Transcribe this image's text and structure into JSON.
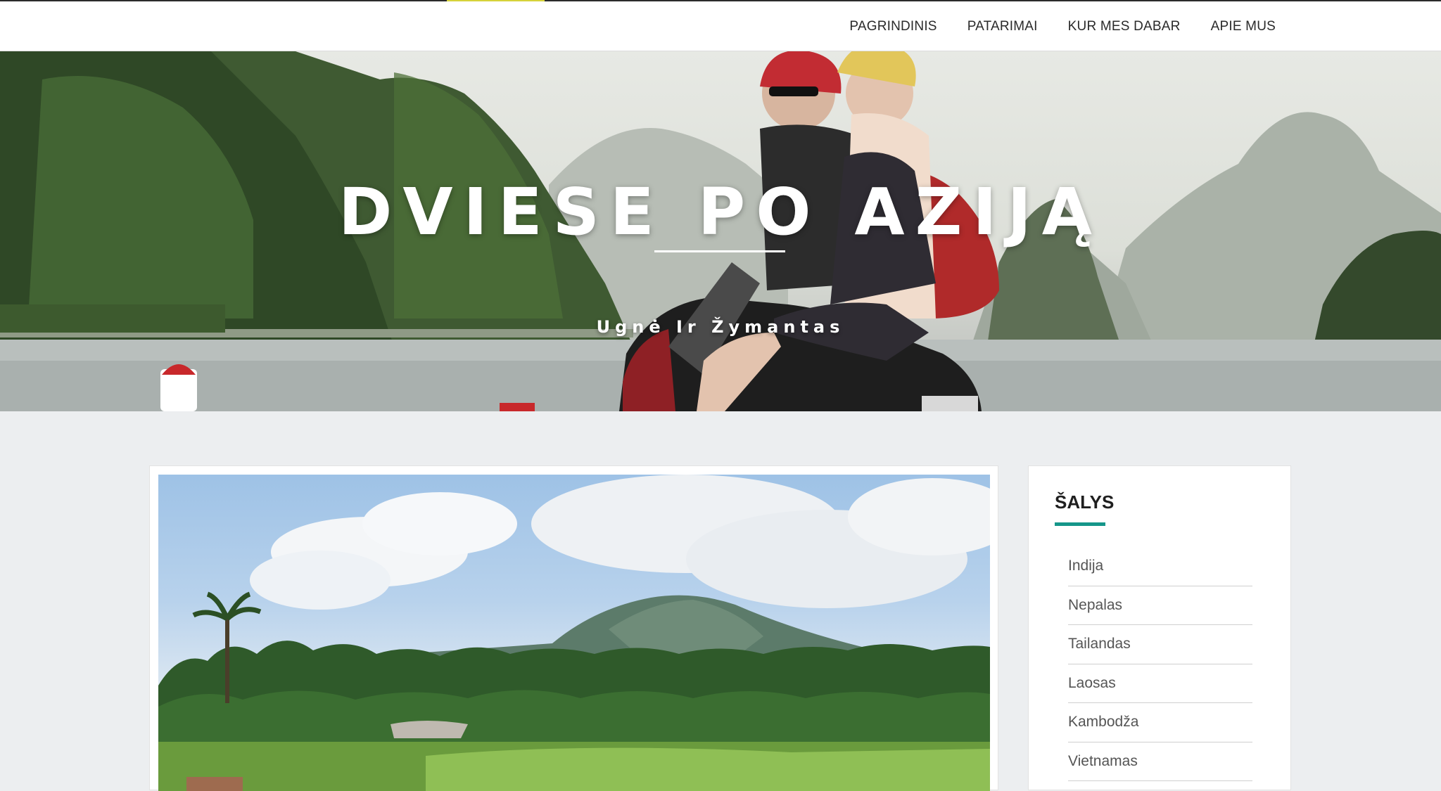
{
  "nav": {
    "items": [
      {
        "label": "PAGRINDINIS"
      },
      {
        "label": "PATARIMAI"
      },
      {
        "label": "KUR MES DABAR"
      },
      {
        "label": "APIE MUS"
      }
    ]
  },
  "hero": {
    "title": "DVIESE PO AZIJĄ",
    "subtitle": "Ugnė Ir Žymantas"
  },
  "sidebar": {
    "title": "ŠALYS",
    "countries": [
      {
        "label": "Indija"
      },
      {
        "label": "Nepalas"
      },
      {
        "label": "Tailandas"
      },
      {
        "label": "Laosas"
      },
      {
        "label": "Kambodža"
      },
      {
        "label": "Vietnamas"
      }
    ]
  },
  "colors": {
    "accent": "#15968a",
    "top_accent": "#d6d23a",
    "background": "#eceef0"
  }
}
